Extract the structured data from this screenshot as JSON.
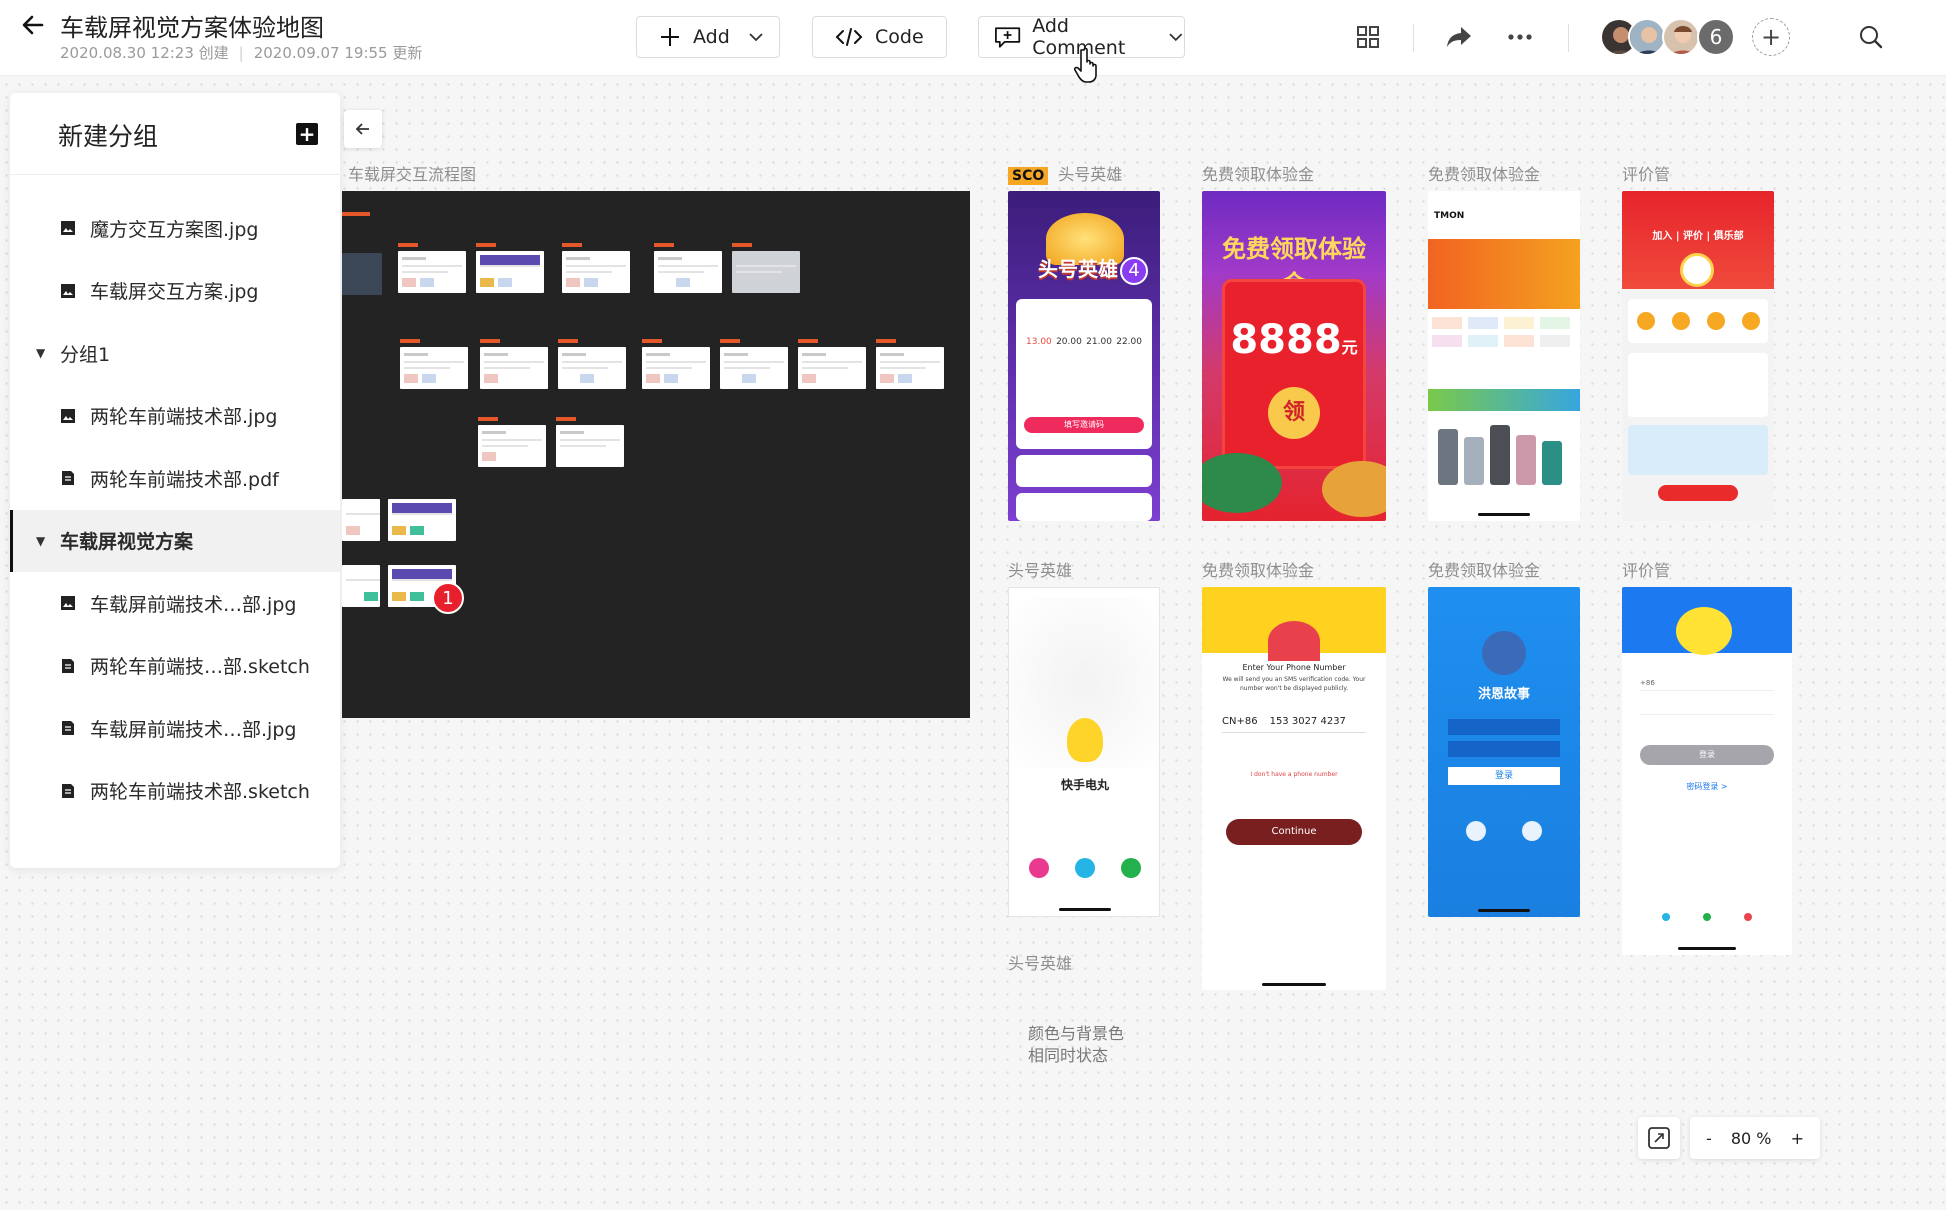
{
  "header": {
    "title": "车载屏视觉方案体验地图",
    "created": "2020.08.30 12:23 创建",
    "updated": "2020.09.07 19:55 更新",
    "add_label": "Add",
    "code_label": "Code",
    "comment_label": "Add Comment",
    "member_extra_count": "6"
  },
  "sidebar": {
    "title": "新建分组",
    "items": [
      {
        "type": "image",
        "label": "魔方交互方案图.jpg"
      },
      {
        "type": "image",
        "label": "车载屏交互方案.jpg"
      },
      {
        "type": "group",
        "label": "分组1"
      },
      {
        "type": "image",
        "label": "两轮车前端技术部.jpg"
      },
      {
        "type": "doc",
        "label": "两轮车前端技术部.pdf"
      },
      {
        "type": "group",
        "label": "车载屏视觉方案",
        "active": true
      },
      {
        "type": "image",
        "label": "车载屏前端技术…部.jpg"
      },
      {
        "type": "doc",
        "label": "两轮车前端技…部.sketch"
      },
      {
        "type": "doc",
        "label": "车载屏前端技术…部.jpg"
      },
      {
        "type": "doc",
        "label": "两轮车前端技术部.sketch"
      }
    ]
  },
  "canvas": {
    "flow_label": "车载屏交互流程图",
    "comment_badge": "1",
    "row1": [
      {
        "tag": "SCO",
        "label": "头号英雄"
      },
      {
        "label": "免费领取体验金"
      },
      {
        "label": "免费领取体验金"
      },
      {
        "label": "评价管"
      }
    ],
    "row2": [
      {
        "label": "头号英雄"
      },
      {
        "label": "免费领取体验金"
      },
      {
        "label": "免费领取体验金"
      },
      {
        "label": "评价管"
      }
    ],
    "bottom_label": "头号英雄",
    "note_line1": "颜色与背景色",
    "note_line2": "相同时状态",
    "screens": {
      "hero_title": "头号英雄",
      "hero_badge": "4",
      "hero_btn": "填写邀请码",
      "hero_times": [
        "13.00",
        "20.00",
        "21.00",
        "22.00"
      ],
      "free_title": "免费领取体验金",
      "free_amount": "8888",
      "free_unit": "元",
      "free_coin": "领",
      "tmon_logo": "TMON",
      "join_text": "加入 | 评价 | 俱乐部",
      "kuaishou_name": "快手电丸",
      "phone_prompt": "Enter Your Phone Number",
      "phone_sub": "We will send you an SMS verification code. Your number won't be displayed publicly.",
      "phone_code": "CN+86",
      "phone_number": "153 3027 4237",
      "phone_link": "I don't have a phone number",
      "continue_label": "Continue",
      "story_title": "洪恩故事",
      "story_btn": "登录",
      "login_btn": "登录",
      "login_alt": "密码登录 >",
      "login_code": "+86"
    }
  },
  "zoom": {
    "minus": "-",
    "value": "80 %",
    "plus": "+"
  }
}
